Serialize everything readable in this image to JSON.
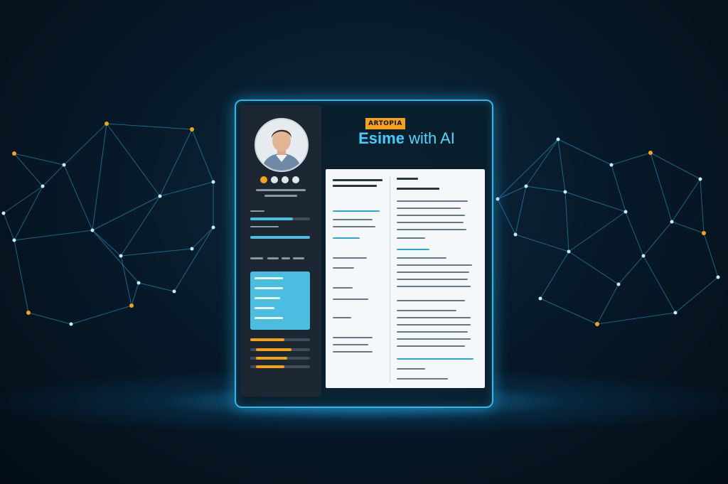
{
  "badge": {
    "label": "ARTOPIA"
  },
  "headline": {
    "part_a": "Esime",
    "part_b": " with AI"
  },
  "colors": {
    "accent_cyan": "#2fb8ea",
    "accent_orange": "#f3a21b",
    "sidebar_bg": "#1c2731",
    "document_bg": "#f4f8fb"
  },
  "icons": [
    "profile-avatar",
    "network-node"
  ]
}
